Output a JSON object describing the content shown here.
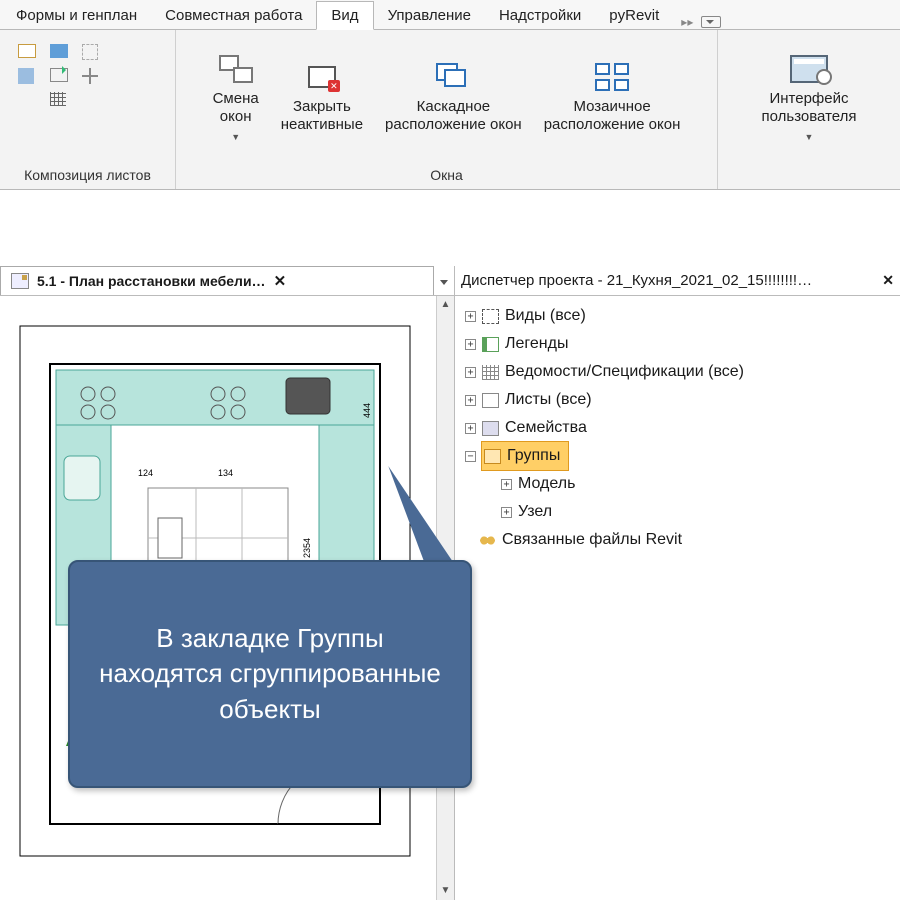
{
  "tabs": {
    "forms": "Формы и генплан",
    "collab": "Совместная работа",
    "view": "Вид",
    "manage": "Управление",
    "addins": "Надстройки",
    "pyrevit": "pyRevit"
  },
  "ribbon": {
    "panel_sheet_comp": "Композиция листов",
    "panel_windows": "Окна",
    "switch_windows": "Смена\nокон",
    "close_inactive": "Закрыть\nнеактивные",
    "cascade": "Каскадное\nрасположение окон",
    "tile": "Мозаичное\nрасположение окон",
    "ui": "Интерфейс\nпользователя"
  },
  "view_tab": {
    "title": "5.1 - План расстановки мебели…"
  },
  "browser": {
    "title": "Диспетчер проекта - 21_Кухня_2021_02_15!!!!!!!!…",
    "views_all": "Виды (все)",
    "legends": "Легенды",
    "schedules": "Ведомости/Спецификации (все)",
    "sheets_all": "Листы (все)",
    "families": "Семейства",
    "groups": "Группы",
    "model": "Модель",
    "detail": "Узел",
    "links": "Связанные файлы Revit"
  },
  "callout": "В закладке Группы находятся сгруппированные объекты",
  "plan_dims": {
    "a": "124",
    "b": "134",
    "c": "444",
    "d": "2354"
  }
}
